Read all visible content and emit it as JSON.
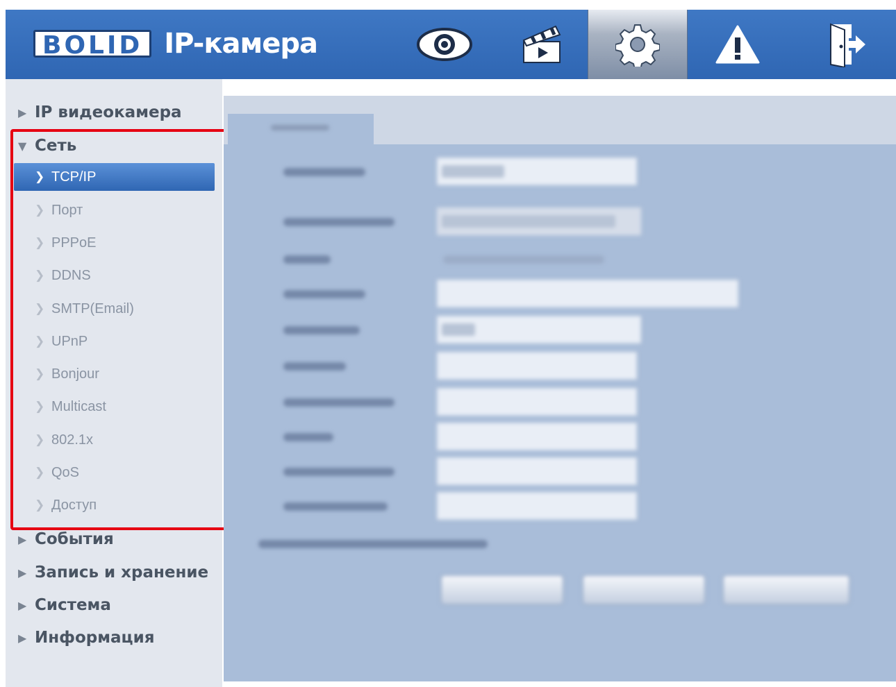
{
  "header": {
    "logo_text": "BOLID",
    "title": "IP-камера",
    "nav": [
      {
        "icon": "eye-icon",
        "label": "Просмотр",
        "active": false
      },
      {
        "icon": "clapperboard-icon",
        "label": "Воспроизведение",
        "active": false
      },
      {
        "icon": "gear-icon",
        "label": "Настройки",
        "active": true
      },
      {
        "icon": "warning-icon",
        "label": "Тревога",
        "active": false
      },
      {
        "icon": "exit-icon",
        "label": "Выход",
        "active": false
      }
    ]
  },
  "sidebar": {
    "groups": [
      {
        "label": "IP видеокамера",
        "expanded": false
      },
      {
        "label": "Сеть",
        "expanded": true
      },
      {
        "label": "События",
        "expanded": false
      },
      {
        "label": "Запись и хранение",
        "expanded": false
      },
      {
        "label": "Система",
        "expanded": false
      },
      {
        "label": "Информация",
        "expanded": false
      }
    ],
    "network_items": [
      {
        "label": "TCP/IP",
        "active": true
      },
      {
        "label": "Порт",
        "active": false
      },
      {
        "label": "PPPoE",
        "active": false
      },
      {
        "label": "DDNS",
        "active": false
      },
      {
        "label": "SMTP(Email)",
        "active": false
      },
      {
        "label": "UPnP",
        "active": false
      },
      {
        "label": "Bonjour",
        "active": false
      },
      {
        "label": "Multicast",
        "active": false
      },
      {
        "label": "802.1x",
        "active": false
      },
      {
        "label": "QoS",
        "active": false
      },
      {
        "label": "Доступ",
        "active": false
      }
    ]
  },
  "colors": {
    "header_blue": "#2f66b3",
    "highlight_red": "#e60012",
    "sidebar_bg": "#e3e7ee",
    "panel_bg": "#a9bdd9"
  }
}
